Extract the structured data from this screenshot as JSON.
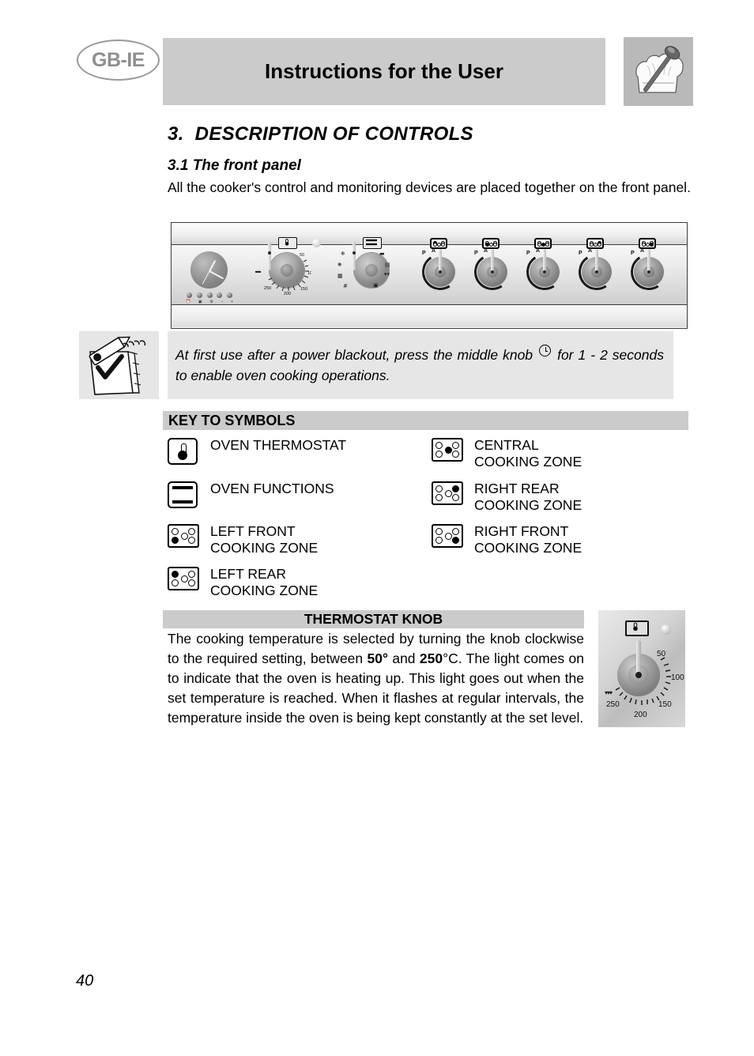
{
  "header": {
    "country_badge": "GB-IE",
    "title": "Instructions for the User",
    "chef_icon": "chef-hat-spoon-icon"
  },
  "section": {
    "number": "3.",
    "title": "DESCRIPTION OF CONTROLS",
    "subsection_title": "3.1 The front panel",
    "intro": "All the cooker's control and monitoring devices are placed together on the front panel."
  },
  "front_panel_figure": {
    "timer_button_labels": [
      "⏰",
      "▣",
      "⚙",
      "−",
      "+"
    ],
    "oven_thermostat_scale": [
      "50",
      "100",
      "150",
      "200",
      "250"
    ],
    "burner_knob_marks": [
      "P",
      "A"
    ],
    "burner_count": 5
  },
  "note": {
    "icon": "notepad-pencil-check-icon",
    "text_before_glyph": "At first use after a power blackout, press the middle knob",
    "glyph": "clock-icon",
    "text_after_glyph": "for 1 - 2 seconds to enable oven cooking operations."
  },
  "key_to_symbols": {
    "header": "KEY TO SYMBOLS",
    "left_column": [
      {
        "icon": "oven-thermostat-icon",
        "label": "OVEN THERMOSTAT"
      },
      {
        "icon": "oven-functions-icon",
        "label": "OVEN FUNCTIONS"
      },
      {
        "icon": "left-front-zone-icon",
        "label": "LEFT FRONT\nCOOKING ZONE",
        "dots": [
          "off",
          "off",
          "off",
          "on",
          "off"
        ]
      },
      {
        "icon": "left-rear-zone-icon",
        "label": "LEFT REAR\nCOOKING ZONE",
        "dots": [
          "on",
          "off",
          "off",
          "off",
          "off"
        ]
      }
    ],
    "right_column": [
      {
        "icon": "central-zone-icon",
        "label": "CENTRAL\nCOOKING ZONE",
        "dots": [
          "off",
          "off",
          "on",
          "off",
          "off"
        ]
      },
      {
        "icon": "right-rear-zone-icon",
        "label": "RIGHT REAR\nCOOKING ZONE",
        "dots": [
          "off",
          "on",
          "off",
          "off",
          "off"
        ]
      },
      {
        "icon": "right-front-zone-icon",
        "label": "RIGHT FRONT\nCOOKING ZONE",
        "dots": [
          "off",
          "off",
          "off",
          "off",
          "on"
        ]
      }
    ]
  },
  "thermostat_knob": {
    "header": "THERMOSTAT KNOB",
    "paragraph_1": "The cooking temperature is selected by turning the knob clockwise to the required setting, between ",
    "temp_min": "50°",
    "paragraph_2": " and ",
    "temp_max": "250",
    "paragraph_3": "°C. The light comes on to indicate that the oven is heating up. This light goes out when the set temperature is reached. When it flashes at regular intervals, the temperature inside the oven is being kept constantly at the set level.",
    "figure": {
      "scale_labels": [
        "50",
        "100",
        "150",
        "200",
        "250"
      ],
      "icon": "oven-thermostat-icon",
      "lamp": "indicator-lamp"
    }
  },
  "footer": {
    "page_number": "40"
  },
  "colors": {
    "band_gray": "#cbcbcb",
    "note_gray": "#e6e6e6",
    "badge_gray": "#8f8f8f"
  }
}
